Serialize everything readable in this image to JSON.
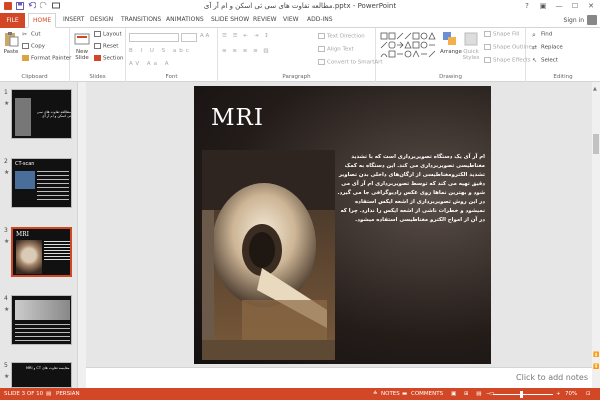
{
  "app": {
    "title": "مطالعه تفاوت های سی تی اسکن و ام آر آی.pptx - PowerPoint",
    "signin": "Sign in"
  },
  "tabs": {
    "file": "FILE",
    "home": "HOME",
    "insert": "INSERT",
    "design": "DESIGN",
    "transitions": "TRANSITIONS",
    "animations": "ANIMATIONS",
    "slideshow": "SLIDE SHOW",
    "review": "REVIEW",
    "view": "VIEW",
    "addins": "ADD-INS"
  },
  "ribbon": {
    "clipboard": {
      "label": "Clipboard",
      "paste": "Paste",
      "cut": "Cut",
      "copy": "Copy",
      "format_painter": "Format Painter"
    },
    "slides": {
      "label": "Slides",
      "new_slide": "New Slide",
      "layout": "Layout",
      "reset": "Reset",
      "section": "Section"
    },
    "font": {
      "label": "Font"
    },
    "paragraph": {
      "label": "Paragraph",
      "text_direction": "Text Direction",
      "align_text": "Align Text",
      "convert_smartart": "Convert to SmartArt"
    },
    "drawing": {
      "label": "Drawing",
      "arrange": "Arrange",
      "quick_styles": "Quick Styles",
      "shape_fill": "Shape Fill",
      "shape_outline": "Shape Outline",
      "shape_effects": "Shape Effects"
    },
    "editing": {
      "label": "Editing",
      "find": "Find",
      "replace": "Replace",
      "select": "Select"
    }
  },
  "thumbnails": [
    {
      "num": "1",
      "title": "مطالعه تفاوت های سی تی اسکن و ام آر آی"
    },
    {
      "num": "2",
      "title": "CT-scan"
    },
    {
      "num": "3",
      "title": "MRI"
    },
    {
      "num": "4",
      "title": ""
    },
    {
      "num": "5",
      "title": "مقایسه تفاوت های CT و MRI"
    }
  ],
  "slide": {
    "title": "MRI",
    "body": "ام آر آی یک دستگاه تصویربرداری است که با تشدید مغناطیسی تصویربرداری می کند. این دستگاه به کمک تشدید الکترومغناطیسی از ارگان‌های داخلی بدن تصاویر دقیق تهیه می کند که توسط تصویربرداری ام آر آی می شود و بهترین نماها روی عکس رادیوگرافی جا می گیرد. در این روش تصویربرداری از اشعه ایکس استفاده نمیشود و خطرات ناشی از اشعه ایکس را ندارد. چرا که در آن از امواج الکترو مغناطیسی استفاده میشود."
  },
  "notes": {
    "placeholder": "Click to add notes"
  },
  "status": {
    "slide": "SLIDE 3 OF 10",
    "language": "PERSIAN",
    "notes": "NOTES",
    "comments": "COMMENTS",
    "zoom": "70%"
  },
  "colors": {
    "accent": "#d24726"
  }
}
